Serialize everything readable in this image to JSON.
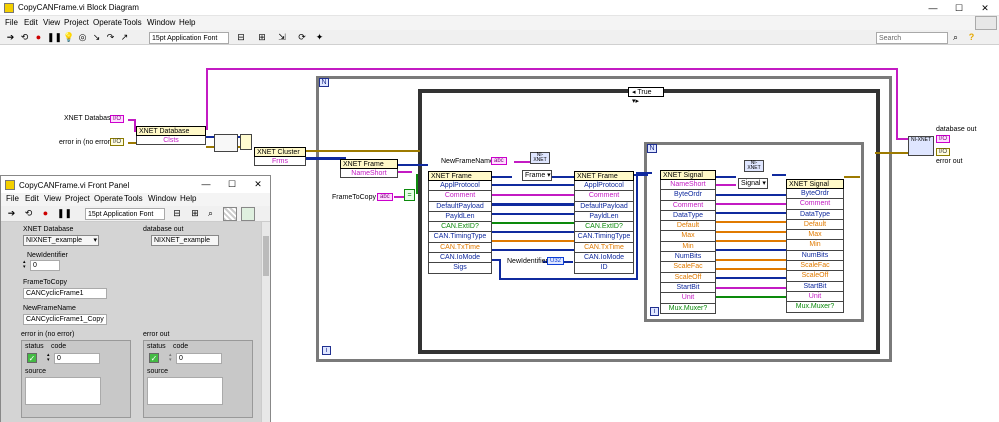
{
  "bd": {
    "title": "CopyCANFrame.vi Block Diagram",
    "window_controls": [
      "—",
      "☐",
      "✕"
    ],
    "menu": [
      "File",
      "Edit",
      "View",
      "Project",
      "Operate",
      "Tools",
      "Window",
      "Help"
    ],
    "font_select": "15pt Application Font",
    "search_placeholder": "Search",
    "help_glyph": "?"
  },
  "diagram": {
    "for_loop_label": "N",
    "outer_loop_index": "i",
    "case_selector": "True",
    "inner_loop_label": "N",
    "inner_loop_index": "i",
    "xnet_database_ctrl": "XNET Database",
    "error_in_ctrl": "error in (no error)",
    "frame_to_copy_ctrl": "FrameToCopy",
    "new_frame_name_ctrl": "NewFrameName",
    "new_identifier_ctrl": "NewIdentifier",
    "database_out_ind": "database out",
    "error_out_ind": "error out",
    "tag_db": "I/O",
    "tag_err": "I/O",
    "tag_abc": "abc",
    "tag_u32": "U32",
    "db_property_node": {
      "title": "XNET Database",
      "props": [
        "Clsts"
      ]
    },
    "cluster_property_node": {
      "title": "XNET Cluster",
      "props": [
        "Frms"
      ]
    },
    "frame_node_1": {
      "title": "XNET Frame",
      "props": [
        "NameShort"
      ]
    },
    "frame_node_2": {
      "title": "XNET Frame",
      "props": [
        "ApplProtocol",
        "Comment",
        "DefaultPayload",
        "PayldLen",
        "CAN.ExtID?",
        "CAN.TimingType",
        "CAN.TxTime",
        "CAN.IoMode",
        "Sigs"
      ]
    },
    "frame_node_3": {
      "title": "XNET Frame",
      "props": [
        "ApplProtocol",
        "Comment",
        "DefaultPayload",
        "PayldLen",
        "CAN.ExtID?",
        "CAN.TimingType",
        "CAN.TxTime",
        "CAN.IoMode",
        "ID"
      ]
    },
    "signal_node_1": {
      "title": "XNET Signal",
      "props": [
        "NameShort",
        "ByteOrdr",
        "Comment",
        "DataType",
        "Default",
        "Max",
        "Min",
        "NumBits",
        "ScaleFac",
        "ScaleOff",
        "StartBit",
        "Unit",
        "Mux.Muxer?"
      ]
    },
    "signal_node_2": {
      "title": "XNET Signal",
      "props": [
        "ByteOrdr",
        "Comment",
        "DataType",
        "Default",
        "Max",
        "Min",
        "NumBits",
        "ScaleFac",
        "ScaleOff",
        "StartBit",
        "Unit",
        "Mux.Muxer?"
      ]
    },
    "create_frame_label": "Frame",
    "create_signal_label": "Signal",
    "new_label": "NI-XNET",
    "equal_glyph": "="
  },
  "fp": {
    "title": "CopyCANFrame.vi Front Panel",
    "menu": [
      "File",
      "Edit",
      "View",
      "Project",
      "Operate",
      "Tools",
      "Window",
      "Help"
    ],
    "font_select": "15pt Application Font",
    "xnet_database_label": "XNET Database",
    "xnet_database_value": "NIXNET_example",
    "database_out_label": "database out",
    "database_out_value": "NIXNET_example",
    "new_identifier_label": "NewIdentifier",
    "new_identifier_value": "0",
    "frame_to_copy_label": "FrameToCopy",
    "frame_to_copy_value": "CANCyclicFrame1",
    "new_frame_name_label": "NewFrameName",
    "new_frame_name_value": "CANCyclicFrame1_Copy",
    "error_in_label": "error in (no error)",
    "error_out_label": "error out",
    "status_label": "status",
    "code_label": "code",
    "code_value_in": "0",
    "code_value_out": "0",
    "source_label": "source",
    "check_glyph": "✓"
  }
}
